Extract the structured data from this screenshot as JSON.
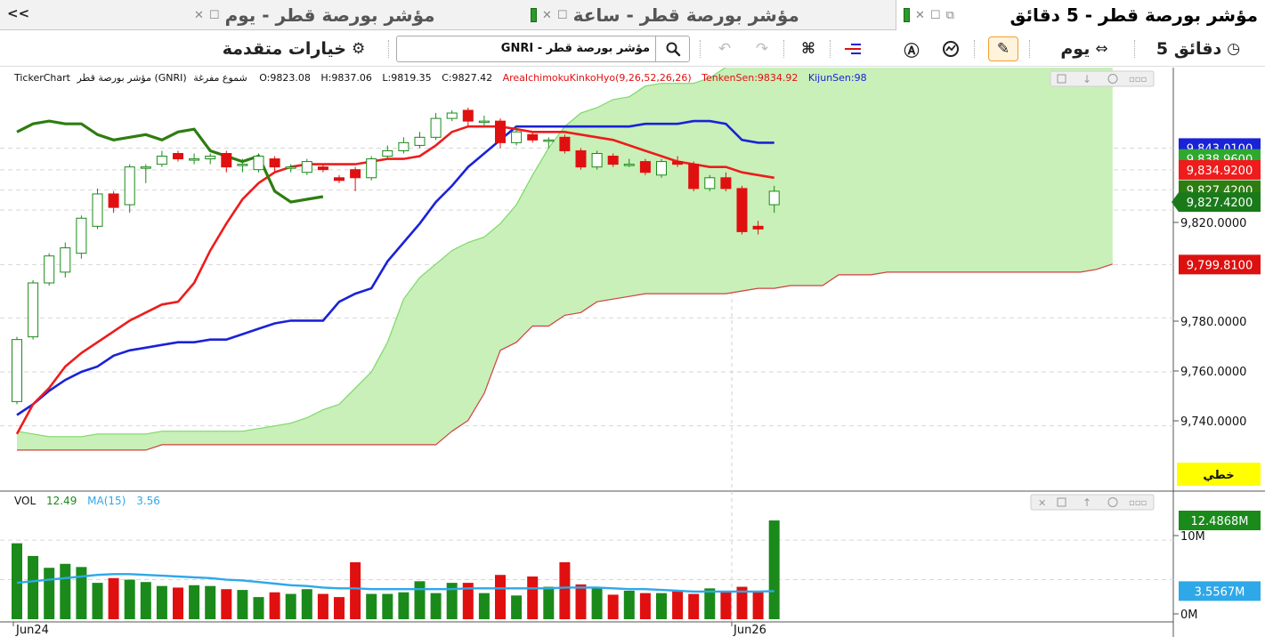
{
  "tabs": {
    "collapse": "<<",
    "items": [
      {
        "label": "مؤشر بورصة قطر - يوم",
        "active": false
      },
      {
        "label": "مؤشر بورصة قطر - ساعة",
        "active": false
      },
      {
        "label": "مؤشر بورصة قطر - 5 دقائق",
        "active": true
      }
    ]
  },
  "toolbar": {
    "interval_label": "5 دقائق",
    "period_label": "يوم",
    "search_value": "GNRI - مؤشر بورصة قطر",
    "advanced_options_label": "خيارات متقدمة"
  },
  "colors": {
    "up": "#1a8a1a",
    "down": "#e01010",
    "tenkan": "#ee1c1c",
    "kijun": "#1a22d8",
    "chikou": "#2e7d10",
    "cloud": "#c8f0b8",
    "volume_ma": "#2ea8e8"
  },
  "price_pane": {
    "info": {
      "source": "TickerChart",
      "symbol": "مؤشر بورصة قطر (GNRI)",
      "chart_style": "شموع مفرغة",
      "open": "O:9823.08",
      "high": "H:9837.06",
      "low": "L:9819.35",
      "close": "C:9827.42",
      "indicator": "AreaIchimokuKinkoHyo(9,26,52,26,26)",
      "tenkan": "TenkenSen:9834.92",
      "kijun": "KijunSen:98"
    },
    "axis_ticks": [
      "9,820.0000",
      "9,780.0000",
      "9,760.0000",
      "9,740.0000"
    ],
    "badges": [
      {
        "value": 9843.01,
        "text": "9,843.0100",
        "color": "#1a22d8"
      },
      {
        "value": 9838.96,
        "text": "9,838.9600",
        "color": "#2ea82e"
      },
      {
        "value": 9834.92,
        "text": "9,834.9200",
        "color": "#ee1c1c"
      },
      {
        "value": 9827.42,
        "text": "9,827.4200",
        "color": "#2e7d10"
      },
      {
        "value": 9823.0,
        "text": "9,827.4200",
        "color": "#1a7a1a"
      },
      {
        "value": 9799.81,
        "text": "9,799.8100",
        "color": "#dd1010"
      }
    ],
    "drawing_badge": "خطي",
    "range": [
      9729,
      9857
    ]
  },
  "volume_pane": {
    "label": "VOL",
    "value": "12.49",
    "ma_label": "MA(15)",
    "ma_value": "3.56",
    "axis_ticks": [
      "10M",
      "0M"
    ],
    "badges": [
      {
        "value": 12.4868,
        "text": "12.4868M",
        "color": "#1a8a1a"
      },
      {
        "value": 3.5567,
        "text": "3.5567M",
        "color": "#2ea8e8"
      }
    ],
    "range": [
      0,
      13.5
    ]
  },
  "time_labels": [
    "Jun24",
    "Jun26"
  ],
  "chart_data": {
    "type": "candlestick",
    "candles": [
      {
        "o": 9749,
        "c": 9772,
        "h": 9773,
        "l": 9748
      },
      {
        "o": 9773,
        "c": 9793,
        "h": 9794,
        "l": 9772
      },
      {
        "o": 9793,
        "c": 9803,
        "h": 9804,
        "l": 9792
      },
      {
        "o": 9797,
        "c": 9806,
        "h": 9808,
        "l": 9795
      },
      {
        "o": 9804,
        "c": 9817,
        "h": 9818,
        "l": 9802
      },
      {
        "o": 9814,
        "c": 9826,
        "h": 9828,
        "l": 9813
      },
      {
        "o": 9826,
        "c": 9821,
        "h": 9827,
        "l": 9819
      },
      {
        "o": 9822,
        "c": 9836,
        "h": 9837,
        "l": 9819
      },
      {
        "o": 9836,
        "c": 9836,
        "h": 9837,
        "l": 9830
      },
      {
        "o": 9837,
        "c": 9840,
        "h": 9842,
        "l": 9836
      },
      {
        "o": 9841,
        "c": 9839,
        "h": 9842,
        "l": 9838
      },
      {
        "o": 9839,
        "c": 9839,
        "h": 9841,
        "l": 9837
      },
      {
        "o": 9839,
        "c": 9840,
        "h": 9841,
        "l": 9837
      },
      {
        "o": 9841,
        "c": 9836,
        "h": 9842,
        "l": 9834
      },
      {
        "o": 9837,
        "c": 9837,
        "h": 9839,
        "l": 9834
      },
      {
        "o": 9835,
        "c": 9840,
        "h": 9841,
        "l": 9834
      },
      {
        "o": 9839,
        "c": 9836,
        "h": 9840,
        "l": 9834
      },
      {
        "o": 9836,
        "c": 9836,
        "h": 9837,
        "l": 9834
      },
      {
        "o": 9834,
        "c": 9838,
        "h": 9839,
        "l": 9833
      },
      {
        "o": 9836,
        "c": 9835,
        "h": 9837,
        "l": 9834
      },
      {
        "o": 9832,
        "c": 9831,
        "h": 9833,
        "l": 9830
      },
      {
        "o": 9835,
        "c": 9832,
        "h": 9836,
        "l": 9827
      },
      {
        "o": 9832,
        "c": 9839,
        "h": 9840,
        "l": 9831
      },
      {
        "o": 9840,
        "c": 9842,
        "h": 9844,
        "l": 9839
      },
      {
        "o": 9842,
        "c": 9845,
        "h": 9847,
        "l": 9841
      },
      {
        "o": 9844,
        "c": 9847,
        "h": 9849,
        "l": 9843
      },
      {
        "o": 9847,
        "c": 9854,
        "h": 9856,
        "l": 9846
      },
      {
        "o": 9854,
        "c": 9856,
        "h": 9857,
        "l": 9853
      },
      {
        "o": 9857,
        "c": 9853,
        "h": 9858,
        "l": 9851
      },
      {
        "o": 9853,
        "c": 9853,
        "h": 9855,
        "l": 9851
      },
      {
        "o": 9853,
        "c": 9845,
        "h": 9854,
        "l": 9843
      },
      {
        "o": 9845,
        "c": 9849,
        "h": 9851,
        "l": 9844
      },
      {
        "o": 9848,
        "c": 9846,
        "h": 9849,
        "l": 9845
      },
      {
        "o": 9846,
        "c": 9846,
        "h": 9847,
        "l": 9843
      },
      {
        "o": 9847,
        "c": 9842,
        "h": 9848,
        "l": 9841
      },
      {
        "o": 9842,
        "c": 9836,
        "h": 9843,
        "l": 9835
      },
      {
        "o": 9836,
        "c": 9841,
        "h": 9842,
        "l": 9835
      },
      {
        "o": 9840,
        "c": 9837,
        "h": 9841,
        "l": 9836
      },
      {
        "o": 9837,
        "c": 9837,
        "h": 9839,
        "l": 9836
      },
      {
        "o": 9838,
        "c": 9834,
        "h": 9839,
        "l": 9833
      },
      {
        "o": 9833,
        "c": 9838,
        "h": 9839,
        "l": 9832
      },
      {
        "o": 9838,
        "c": 9837,
        "h": 9840,
        "l": 9836
      },
      {
        "o": 9837,
        "c": 9828,
        "h": 9838,
        "l": 9827
      },
      {
        "o": 9828,
        "c": 9832,
        "h": 9833,
        "l": 9827
      },
      {
        "o": 9832,
        "c": 9828,
        "h": 9834,
        "l": 9827
      },
      {
        "o": 9828,
        "c": 9812,
        "h": 9829,
        "l": 9811
      },
      {
        "o": 9814,
        "c": 9813,
        "h": 9816,
        "l": 9811
      },
      {
        "o": 9822,
        "c": 9827,
        "h": 9829,
        "l": 9819
      }
    ],
    "volume": [
      9.6,
      8.0,
      6.5,
      7.0,
      6.6,
      4.6,
      5.2,
      5.0,
      4.7,
      4.2,
      4.0,
      4.3,
      4.2,
      3.8,
      3.7,
      2.8,
      3.4,
      3.2,
      3.8,
      3.2,
      2.8,
      7.2,
      3.2,
      3.2,
      3.4,
      4.8,
      3.3,
      4.6,
      4.6,
      3.3,
      5.6,
      3.0,
      5.4,
      4.1,
      7.2,
      4.4,
      4.1,
      3.1,
      3.6,
      3.3,
      3.3,
      3.5,
      3.2,
      3.9,
      3.4,
      4.1,
      3.5,
      12.49
    ],
    "volume_ma": [
      4.6,
      4.8,
      5.0,
      5.2,
      5.4,
      5.6,
      5.7,
      5.7,
      5.6,
      5.5,
      5.4,
      5.3,
      5.2,
      5.0,
      4.9,
      4.7,
      4.5,
      4.3,
      4.2,
      4.0,
      3.9,
      3.9,
      3.8,
      3.8,
      3.8,
      3.8,
      3.8,
      3.8,
      3.9,
      3.9,
      3.9,
      3.9,
      3.9,
      3.9,
      4.0,
      4.0,
      4.0,
      3.9,
      3.8,
      3.8,
      3.7,
      3.6,
      3.5,
      3.5,
      3.5,
      3.5,
      3.5,
      3.56
    ],
    "tenkan": [
      9737,
      9748,
      9754,
      9762,
      9767,
      9771,
      9775,
      9779,
      9782,
      9785,
      9786,
      9793,
      9805,
      9815,
      9824,
      9830,
      9834,
      9836,
      9837,
      9837,
      9837,
      9837,
      9838,
      9839,
      9839,
      9840,
      9844,
      9849,
      9851,
      9851,
      9851,
      9850,
      9849,
      9849,
      9849,
      9848,
      9847,
      9846,
      9844,
      9842,
      9840,
      9838,
      9837,
      9836,
      9836,
      9834,
      9833,
      9832
    ],
    "kijun": [
      9744,
      9748,
      9753,
      9757,
      9760,
      9762,
      9766,
      9768,
      9769,
      9770,
      9771,
      9771,
      9772,
      9772,
      9774,
      9776,
      9778,
      9779,
      9779,
      9779,
      9786,
      9789,
      9791,
      9801,
      9808,
      9815,
      9823,
      9829,
      9836,
      9841,
      9846,
      9851,
      9851,
      9851,
      9851,
      9851,
      9851,
      9851,
      9851,
      9852,
      9852,
      9852,
      9853,
      9853,
      9852,
      9846,
      9845,
      9845
    ],
    "chikou": [
      9849,
      9852,
      9853,
      9852,
      9852,
      9848,
      9846,
      9847,
      9848,
      9846,
      9849,
      9850,
      9842,
      9840,
      9838,
      9840,
      9827,
      9823,
      9824,
      9825
    ],
    "span_a": [
      9738,
      9737,
      9736,
      9736,
      9736,
      9737,
      9737,
      9737,
      9737,
      9738,
      9738,
      9738,
      9738,
      9738,
      9738,
      9739,
      9740,
      9741,
      9743,
      9746,
      9748,
      9754,
      9760,
      9771,
      9787,
      9795,
      9800,
      9805,
      9808,
      9810,
      9815,
      9822,
      9833,
      9843,
      9851,
      9856,
      9858,
      9861,
      9862,
      9866,
      9867,
      9867,
      9867,
      9869,
      9873,
      9883,
      9887,
      9887,
      9888,
      9888,
      9889,
      9893,
      9898,
      9908,
      9914,
      9919,
      9924,
      9929,
      9933,
      9938,
      9942,
      9945,
      9946,
      9948,
      9947,
      9945,
      9944,
      9941,
      9938
    ],
    "span_b": [
      9731,
      9731,
      9731,
      9731,
      9731,
      9731,
      9731,
      9731,
      9731,
      9733,
      9733,
      9733,
      9733,
      9733,
      9733,
      9733,
      9733,
      9733,
      9733,
      9733,
      9733,
      9733,
      9733,
      9733,
      9733,
      9733,
      9733,
      9738,
      9742,
      9752,
      9768,
      9771,
      9777,
      9777,
      9781,
      9782,
      9786,
      9787,
      9788,
      9789,
      9789,
      9789,
      9789,
      9789,
      9789,
      9790,
      9791,
      9791,
      9792,
      9792,
      9792,
      9796,
      9796,
      9796,
      9797,
      9797,
      9797,
      9797,
      9797,
      9797,
      9797,
      9797,
      9797,
      9797,
      9797,
      9797,
      9797,
      9798,
      9800
    ],
    "y_range": [
      9729,
      9857
    ],
    "xlabels": [
      "Jun24",
      "Jun26"
    ]
  }
}
